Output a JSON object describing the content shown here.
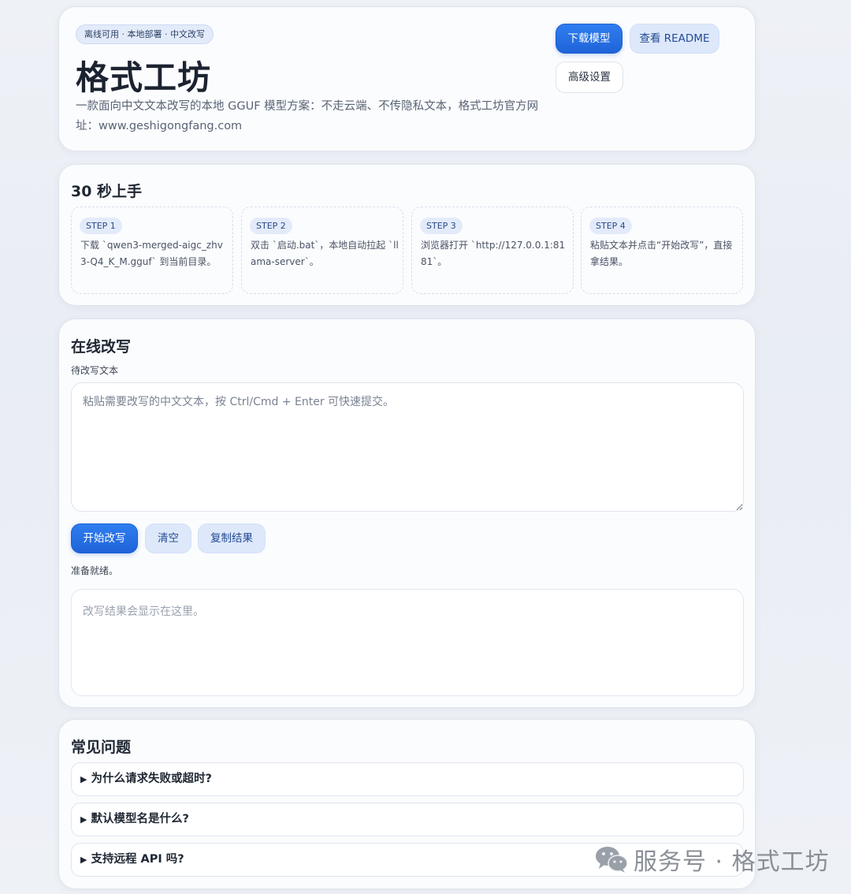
{
  "hero": {
    "badge": "离线可用 · 本地部署 · 中文改写",
    "title": "格式工坊",
    "description": "一款面向中文文本改写的本地 GGUF 模型方案：不走云端、不传隐私文本，格式工坊官方网址：www.geshigongfang.com",
    "buttons": {
      "download": "下载模型",
      "readme": "查看 README",
      "advanced": "高级设置"
    }
  },
  "quickstart": {
    "title": "30 秒上手",
    "steps": [
      {
        "label": "STEP 1",
        "text": "下载 `qwen3-merged-aigc_zhv3-Q4_K_M.gguf` 到当前目录。"
      },
      {
        "label": "STEP 2",
        "text": "双击 `启动.bat`，本地自动拉起 `llama-server`。"
      },
      {
        "label": "STEP 3",
        "text": "浏览器打开 `http://127.0.0.1:8181`。"
      },
      {
        "label": "STEP 4",
        "text": "粘贴文本并点击“开始改写”，直接拿结果。"
      }
    ]
  },
  "rewrite": {
    "title": "在线改写",
    "input_label": "待改写文本",
    "input_placeholder": "粘贴需要改写的中文文本，按 Ctrl/Cmd + Enter 可快速提交。",
    "buttons": {
      "start": "开始改写",
      "clear": "清空",
      "copy": "复制结果"
    },
    "status": "准备就绪。",
    "output_placeholder": "改写结果会显示在这里。"
  },
  "faq": {
    "title": "常见问题",
    "items": [
      {
        "question": "为什么请求失败或超时?"
      },
      {
        "question": "默认模型名是什么?"
      },
      {
        "question": "支持远程 API 吗?"
      }
    ]
  },
  "watermark": {
    "text": "服务号 · 格式工坊",
    "icon": "wechat-icon"
  },
  "colors": {
    "accent": "#1f63d8",
    "soft_button": "#dde8fb",
    "background": "#eef1f6"
  }
}
